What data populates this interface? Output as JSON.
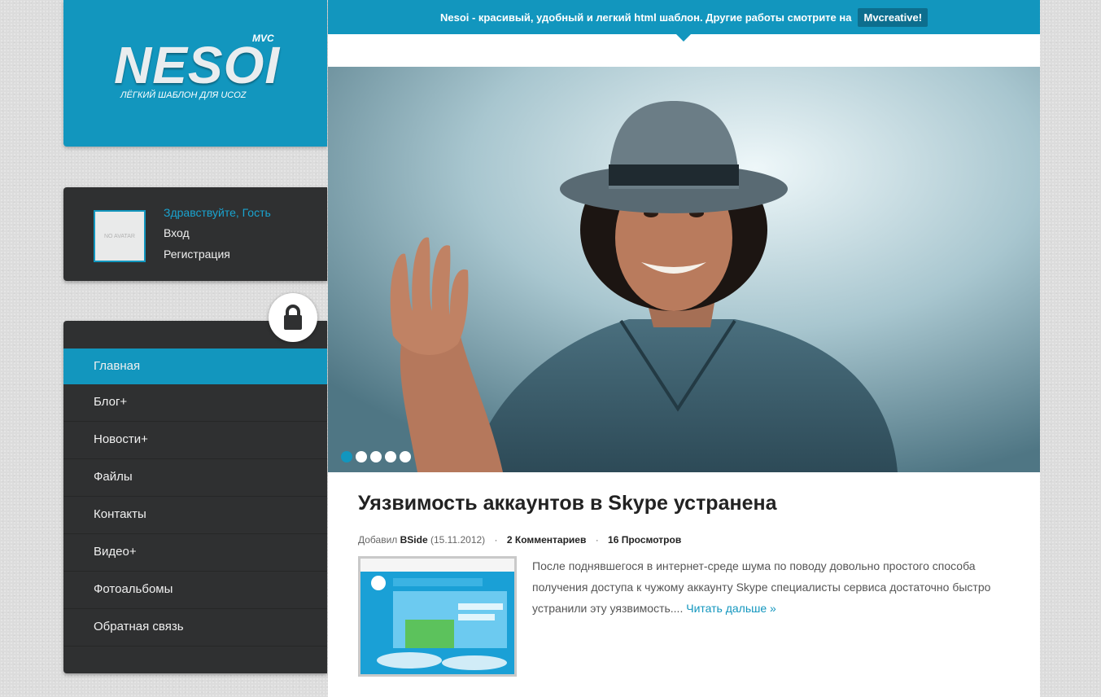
{
  "logo": {
    "title": "NESOI",
    "badge": "MVC",
    "subtitle": "ЛЁГКИЙ ШАБЛОН ДЛЯ UCOZ"
  },
  "user_panel": {
    "avatar_text": "NO AVATAR",
    "greeting": "Здравствуйте, Гость",
    "login": "Вход",
    "register": "Регистрация"
  },
  "lock_icon": "lock-icon",
  "nav": {
    "items": [
      {
        "label": "Главная",
        "active": true
      },
      {
        "label": "Блог+"
      },
      {
        "label": "Новости+"
      },
      {
        "label": "Файлы"
      },
      {
        "label": "Контакты"
      },
      {
        "label": "Видео+"
      },
      {
        "label": "Фотоальбомы"
      },
      {
        "label": "Обратная связь"
      }
    ]
  },
  "topbar": {
    "text": "Nesoi - красивый, удобный и легкий html шаблон. Другие работы смотрите на",
    "button": "Mvcreative!"
  },
  "slider": {
    "dots": 5,
    "active_dot": 1
  },
  "post": {
    "title": "Уязвимость аккаунтов в Skype устранена",
    "added_by_label": "Добавил",
    "author": "BSide",
    "date": "(15.11.2012)",
    "comments": "2 Комментариев",
    "views": "16 Просмотров",
    "excerpt": "После поднявшегося в интернет-среде шума по поводу довольно простого способа получения доступа к чужому аккаунту Skype специалисты сервиса достаточно быстро устранили эту уязвимость....",
    "read_more": "Читать дальше »"
  },
  "colors": {
    "accent": "#1296be",
    "dark_panel": "#2f3031"
  }
}
